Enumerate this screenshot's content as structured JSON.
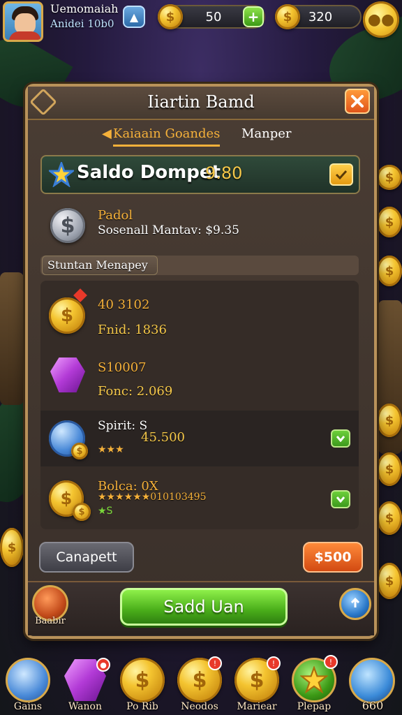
{
  "player": {
    "name": "Uemomaiah",
    "subtitle": "Anidei 10b0"
  },
  "currency": {
    "coins": "50",
    "gems": "320"
  },
  "dialog": {
    "title": "Iiartin Bamd"
  },
  "tabs": [
    {
      "label": "Kaiaain Goandes"
    },
    {
      "label": "Manper"
    }
  ],
  "balance": {
    "label": "Saldo Dompet",
    "value": "9.80"
  },
  "account": {
    "name": "Padol",
    "detail": "Sosenall Mantav: $9.35"
  },
  "section": {
    "title": "Stuntan Menapey"
  },
  "items": [
    {
      "title": "40 3102",
      "sub": "Fnid: 1836",
      "icon": "gold-coin-icon"
    },
    {
      "title": "S10007",
      "sub": "Fonc: 2.069",
      "icon": "purple-gem-icon"
    },
    {
      "title": "Spirit: S",
      "value": "45.500",
      "stars": "★★★",
      "icon": "blue-coin-icon"
    },
    {
      "title": "Bolca: 0X",
      "sub": "★★★★★★010103495",
      "stars": "★S",
      "icon": "coin-stack-icon"
    }
  ],
  "buttons": {
    "cancel": "Canapett",
    "price": "$500",
    "primary": "Sadd Uan",
    "left_icon": "Baabir"
  },
  "dock": [
    {
      "label": "Gains",
      "icon": "star-gem-icon"
    },
    {
      "label": "Wanon",
      "icon": "purple-gem-icon"
    },
    {
      "label": "Po Rib",
      "icon": "gold-coin-icon"
    },
    {
      "label": "Neodos",
      "icon": "gold-coin-icon"
    },
    {
      "label": "Mariear",
      "icon": "gold-coin-icon"
    },
    {
      "label": "Plepap",
      "icon": "star-icon"
    },
    {
      "label": "660",
      "icon": "crystal-icon"
    }
  ],
  "colors": {
    "accent": "#f5b13a",
    "primary_green": "#4aae1a",
    "orange": "#e0541a",
    "panel_border": "#b9925a"
  }
}
